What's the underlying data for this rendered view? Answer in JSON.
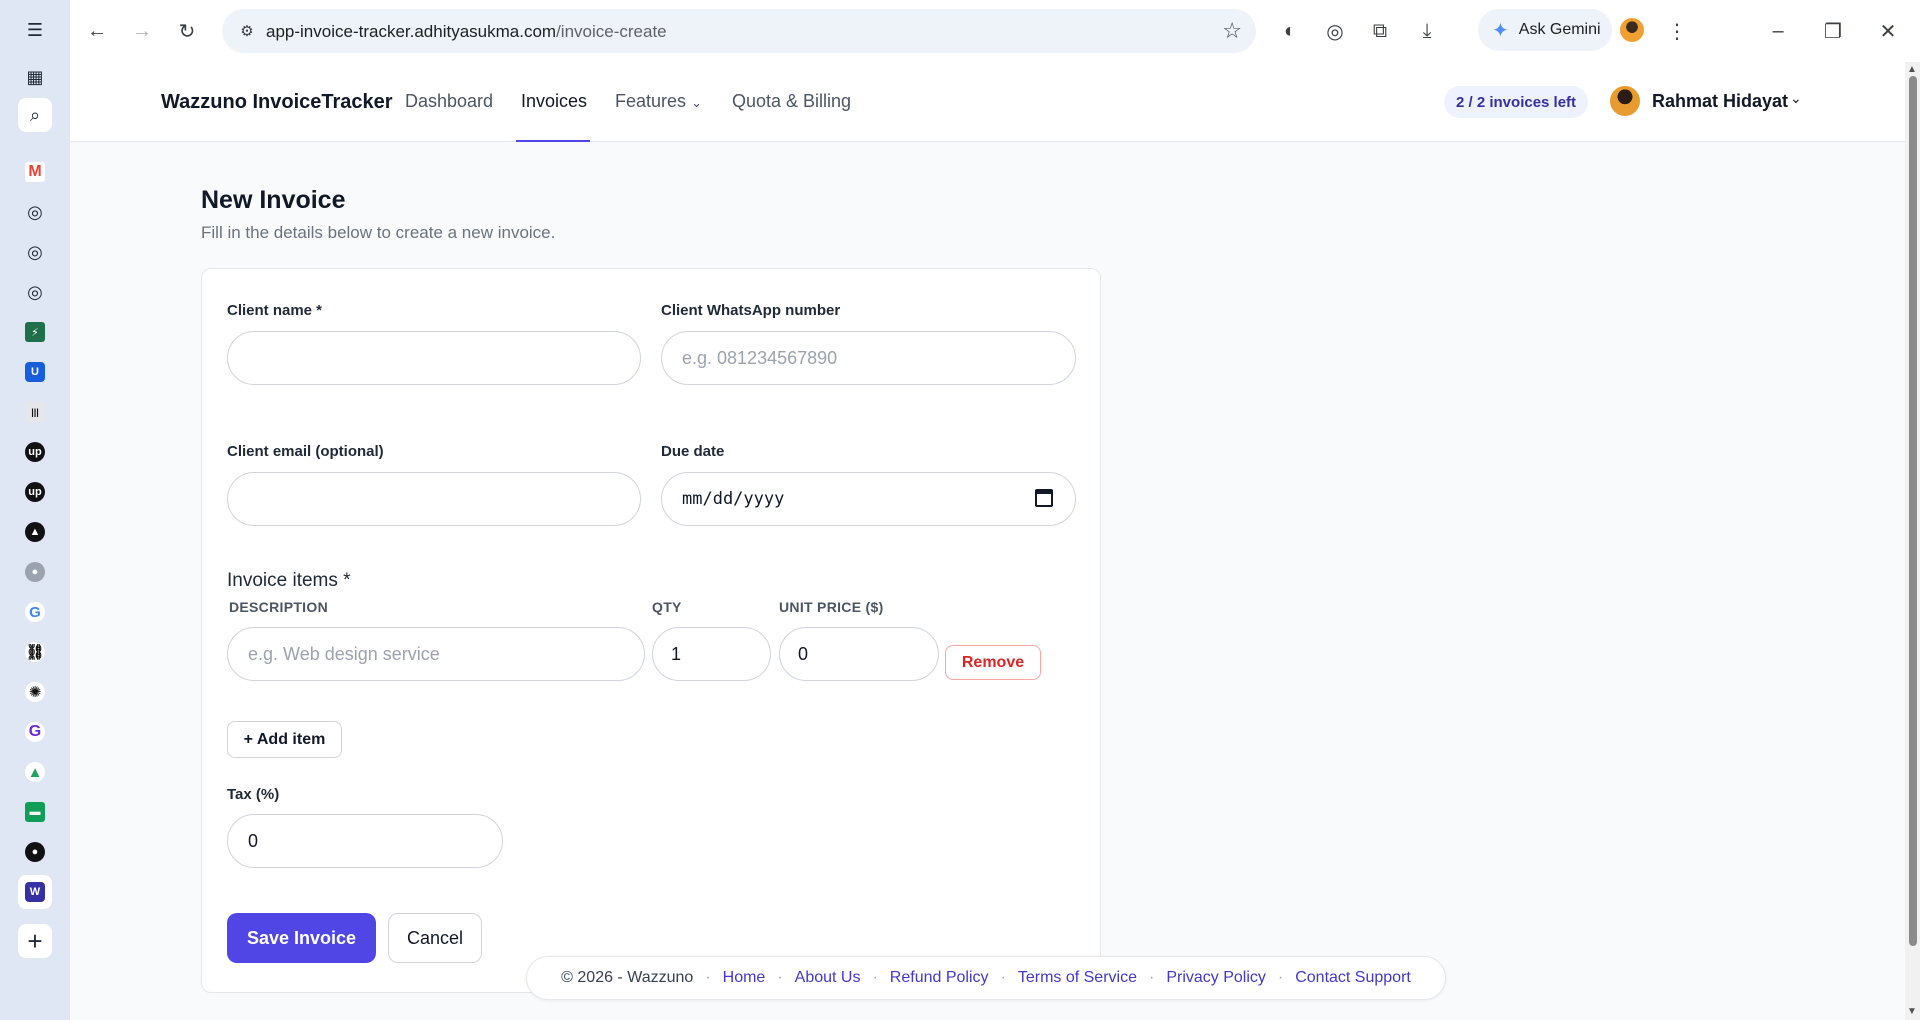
{
  "browser": {
    "url_domain": "app-invoice-tracker.adhityasukma.com",
    "url_path": "/invoice-create",
    "gemini_label": "Ask Gemini"
  },
  "app": {
    "brand": "Wazzuno InvoiceTracker",
    "nav": [
      "Dashboard",
      "Invoices",
      "Features",
      "Quota & Billing"
    ],
    "active_nav": "Invoices",
    "quota_badge": "2 / 2 invoices left",
    "user_name": "Rahmat Hidayat"
  },
  "form": {
    "title": "New Invoice",
    "subtitle": "Fill in the details below to create a new invoice.",
    "client_name_label": "Client name *",
    "client_name_value": "",
    "whatsapp_label": "Client WhatsApp number",
    "whatsapp_placeholder": "e.g. 081234567890",
    "email_label": "Client email (optional)",
    "email_value": "",
    "due_date_label": "Due date",
    "due_date_placeholder": "mm/dd/yyyy",
    "items_label": "Invoice items *",
    "col_description": "DESCRIPTION",
    "col_qty": "QTY",
    "col_unit_price": "UNIT PRICE ($)",
    "item_description_placeholder": "e.g. Web design service",
    "item_qty": "1",
    "item_unit_price": "0",
    "remove_label": "Remove",
    "add_item_label": "+ Add item",
    "tax_label": "Tax (%)",
    "tax_value": "0",
    "save_label": "Save Invoice",
    "cancel_label": "Cancel"
  },
  "footer": {
    "copyright": "© 2026 - Wazzuno",
    "links": [
      "Home",
      "About Us",
      "Refund Policy",
      "Terms of Service",
      "Privacy Policy",
      "Contact Support"
    ]
  },
  "sidebar_icons": [
    "menu-icon",
    "tab-groups-icon",
    "search-tabs-icon",
    "gmail-icon",
    "target-icon",
    "target-icon",
    "target-icon",
    "bolt-icon",
    "bitwarden-icon",
    "barcode-icon",
    "upwork-icon",
    "upwork-icon",
    "triangle-icon",
    "globe-icon",
    "google-icon",
    "link-icon",
    "openai-icon",
    "grammarly-icon",
    "drive-icon",
    "sheets-icon",
    "github-icon",
    "wazzuno-icon",
    "add-icon"
  ],
  "colors": {
    "accent": "#4f46e5",
    "danger": "#dc2626",
    "badge_bg": "#eef2ff"
  }
}
